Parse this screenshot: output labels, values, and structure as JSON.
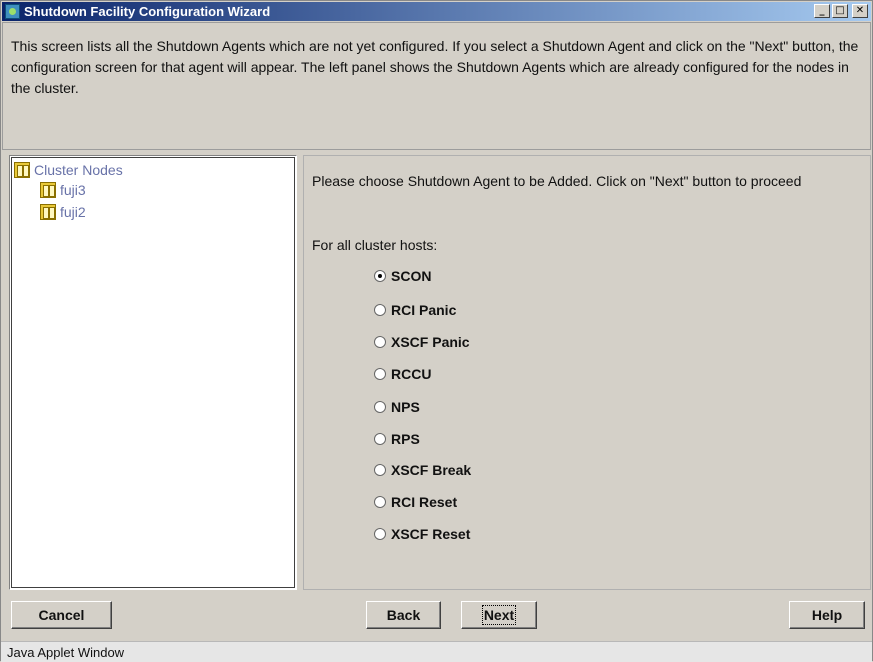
{
  "window": {
    "title": "Shutdown Facility Configuration Wizard",
    "minimize_glyph": "_",
    "maximize_glyph": "□",
    "close_glyph": "✕"
  },
  "info": {
    "text": "This screen lists all the Shutdown Agents which are not yet configured. If you select a Shutdown Agent and click on the \"Next\" button, the configuration screen for that agent will appear. The left panel shows the Shutdown Agents which are already configured for the nodes in the cluster."
  },
  "tree": {
    "root": "Cluster Nodes",
    "children": [
      "fuji3",
      "fuji2"
    ]
  },
  "main": {
    "prompt": "Please choose Shutdown Agent to be Added. Click on \"Next\" button to proceed",
    "subhead": "For all cluster hosts:",
    "selected": "SCON",
    "options": [
      "SCON",
      "RCI Panic",
      "XSCF Panic",
      "RCCU",
      "NPS",
      "RPS",
      "XSCF Break",
      "RCI Reset",
      "XSCF Reset"
    ]
  },
  "buttons": {
    "cancel": "Cancel",
    "back": "Back",
    "next": "Next",
    "help": "Help"
  },
  "status": {
    "text": "Java Applet Window"
  }
}
